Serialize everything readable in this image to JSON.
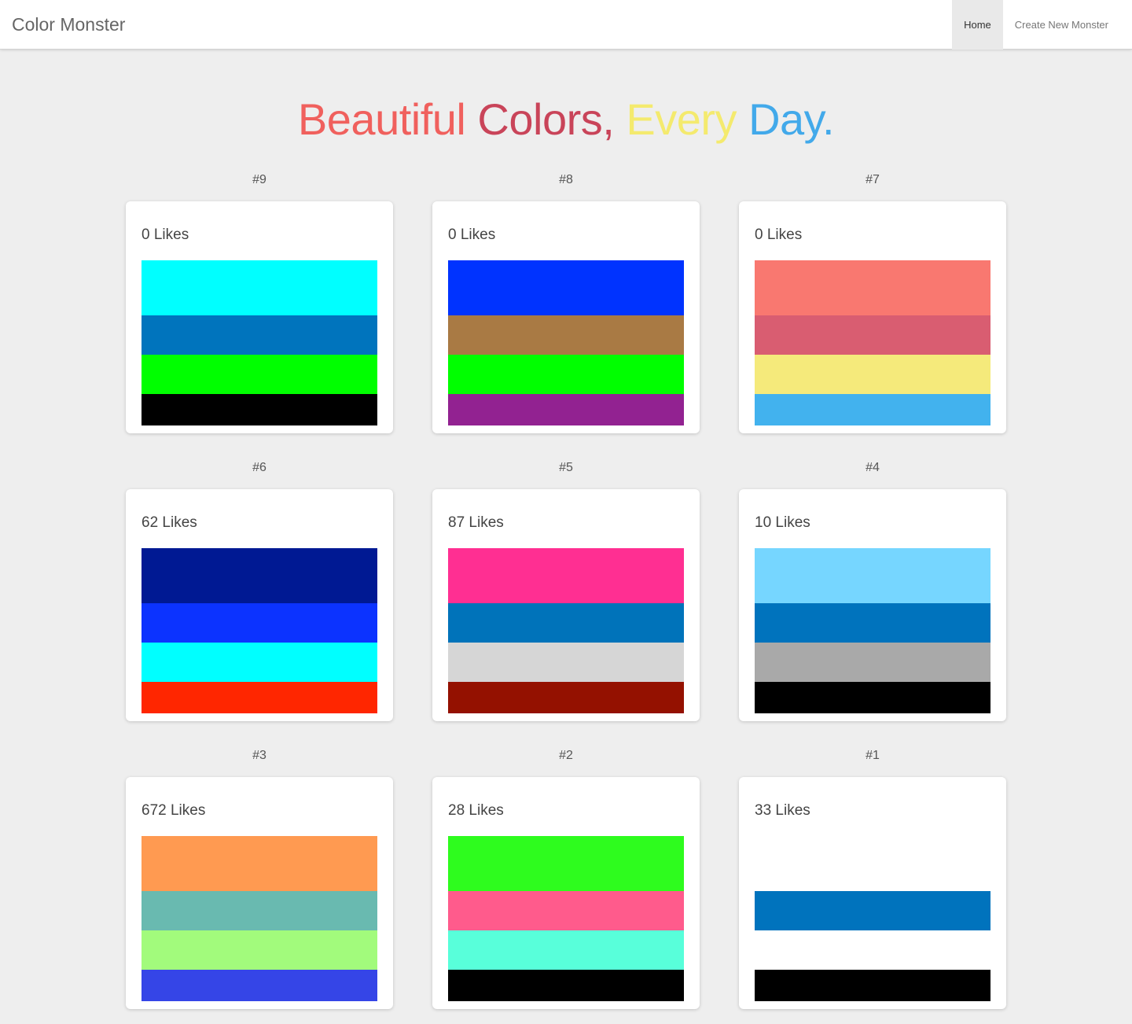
{
  "navbar": {
    "brand": "Color Monster",
    "links": [
      {
        "label": "Home",
        "active": true
      },
      {
        "label": "Create New Monster",
        "active": false
      }
    ]
  },
  "hero": {
    "words": [
      {
        "text": "Beautiful ",
        "color": "#f0605d"
      },
      {
        "text": "Colors, ",
        "color": "#c94459"
      },
      {
        "text": "Every ",
        "color": "#f4ea6e"
      },
      {
        "text": "Day.",
        "color": "#42a9ea"
      }
    ]
  },
  "monsters": [
    {
      "number": "#9",
      "likes": "0 Likes",
      "colors": [
        "#00ffff",
        "#0074bd",
        "#00ff00",
        "#000000"
      ]
    },
    {
      "number": "#8",
      "likes": "0 Likes",
      "colors": [
        "#0033ff",
        "#a97a44",
        "#00ff00",
        "#922291"
      ]
    },
    {
      "number": "#7",
      "likes": "0 Likes",
      "colors": [
        "#f97870",
        "#d95d71",
        "#f5ea7b",
        "#42b2ee"
      ]
    },
    {
      "number": "#6",
      "likes": "62 Likes",
      "colors": [
        "#001993",
        "#0c33ff",
        "#00ffff",
        "#ff2600"
      ]
    },
    {
      "number": "#5",
      "likes": "87 Likes",
      "colors": [
        "#ff2f92",
        "#0073ba",
        "#d6d6d6",
        "#941100"
      ]
    },
    {
      "number": "#4",
      "likes": "10 Likes",
      "colors": [
        "#76d6ff",
        "#0073bd",
        "#a9a9a9",
        "#000000"
      ]
    },
    {
      "number": "#3",
      "likes": "672 Likes",
      "colors": [
        "#ff9a51",
        "#69bab0",
        "#a2fb7c",
        "#3545e7"
      ]
    },
    {
      "number": "#2",
      "likes": "28 Likes",
      "colors": [
        "#2efc1e",
        "#ff5b8c",
        "#58ffda",
        "#000000"
      ]
    },
    {
      "number": "#1",
      "likes": "33 Likes",
      "colors": [
        "#ffffff",
        "#0073bd",
        "#ffffff",
        "#000000"
      ]
    }
  ]
}
